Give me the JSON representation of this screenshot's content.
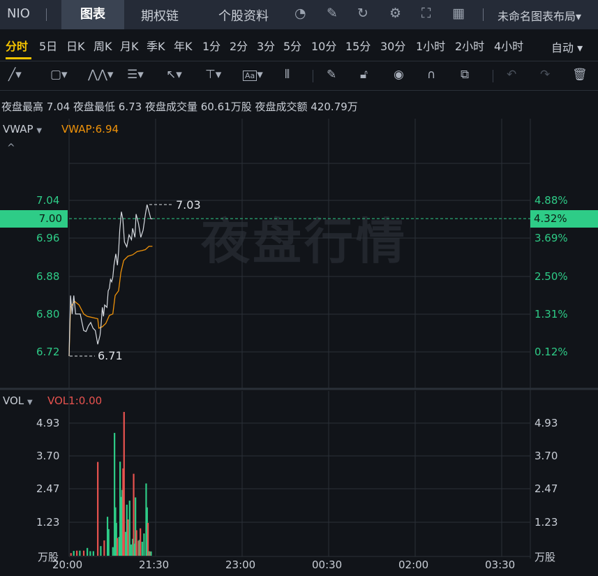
{
  "header": {
    "symbol": "NIO",
    "tabs": [
      "图表",
      "期权链",
      "个股资料"
    ],
    "icons": [
      "gauge-icon",
      "edit-icon",
      "refresh-icon",
      "gear-icon",
      "fullscreen-icon",
      "grid-icon"
    ],
    "layout_name": "未命名图表布局"
  },
  "periods": {
    "items": [
      "分时",
      "5日",
      "日K",
      "周K",
      "月K",
      "季K",
      "年K",
      "1分",
      "2分",
      "3分",
      "5分",
      "10分",
      "15分",
      "30分",
      "1小时",
      "2小时",
      "4小时"
    ],
    "active": "分时",
    "mode": "自动"
  },
  "toolbar": {
    "tools": [
      "line-tool-icon",
      "rectangle-tool-icon",
      "pattern-tool-icon",
      "fib-tool-icon",
      "arrow-tool-icon",
      "measure-tool-icon",
      "text-tool-icon",
      "candle-tool-icon",
      "pen-icon",
      "unlock-icon",
      "eye-icon",
      "magnet-icon",
      "link-icon",
      "undo-icon",
      "redo-icon",
      "trash-icon"
    ]
  },
  "info": {
    "high_label": "夜盘最高",
    "high": "7.04",
    "low_label": "夜盘最低",
    "low": "6.73",
    "vol_label": "夜盘成交量",
    "vol": "60.61万股",
    "amt_label": "夜盘成交额",
    "amt": "420.79万"
  },
  "price_panel": {
    "indicator": "VWAP",
    "indicator_value": "VWAP:6.94",
    "watermark": "夜盘行情",
    "left_ticks": [
      "7.04",
      "6.96",
      "6.88",
      "6.80",
      "6.72"
    ],
    "right_ticks": [
      "4.88%",
      "3.69%",
      "2.50%",
      "1.31%",
      "0.12%"
    ],
    "current_price": "7.00",
    "current_pct": "4.32%",
    "max_label": "7.03",
    "min_label": "6.71"
  },
  "volume_panel": {
    "indicator": "VOL",
    "indicator_value": "VOL1:0.00",
    "ticks": [
      "4.93",
      "3.70",
      "2.47",
      "1.23"
    ],
    "unit": "万股"
  },
  "time_axis": [
    "20:00",
    "21:30",
    "23:00",
    "00:30",
    "02:00",
    "03:30"
  ],
  "colors": {
    "up": "#2ecc87",
    "down": "#e8534f",
    "vwap": "#f0930a",
    "price": "#d8dce2",
    "accent": "#f5c400"
  },
  "chart_data": {
    "type": "line",
    "x_unit": "minutes since 20:00",
    "price_ylim": [
      6.7,
      7.08
    ],
    "price": [
      [
        0,
        6.711
      ],
      [
        1.5,
        6.839
      ],
      [
        3.2,
        6.8
      ],
      [
        4.9,
        6.839
      ],
      [
        6.8,
        6.8
      ],
      [
        11.6,
        6.8
      ],
      [
        15.2,
        6.765
      ],
      [
        17.7,
        6.763
      ],
      [
        20.1,
        6.775
      ],
      [
        22.5,
        6.782
      ],
      [
        24.9,
        6.77
      ],
      [
        27.3,
        6.765
      ],
      [
        29.8,
        6.736
      ],
      [
        32.2,
        6.755
      ],
      [
        33.4,
        6.78
      ],
      [
        34.6,
        6.814
      ],
      [
        35.8,
        6.795
      ],
      [
        37,
        6.819
      ],
      [
        39.4,
        6.814
      ],
      [
        40.7,
        6.849
      ],
      [
        41.9,
        6.854
      ],
      [
        43.1,
        6.873
      ],
      [
        44.3,
        6.868
      ],
      [
        45.5,
        6.878
      ],
      [
        46.7,
        6.903
      ],
      [
        48.6,
        6.927
      ],
      [
        50.3,
        6.903
      ],
      [
        51.5,
        6.932
      ],
      [
        52.7,
        6.977
      ],
      [
        54.4,
        7.016
      ],
      [
        55.9,
        7.001
      ],
      [
        57.6,
        6.952
      ],
      [
        60,
        6.942
      ],
      [
        62.4,
        6.967
      ],
      [
        64.9,
        6.957
      ],
      [
        66.1,
        6.981
      ],
      [
        68.5,
        6.962
      ],
      [
        69.7,
        7.011
      ],
      [
        72.2,
        6.991
      ],
      [
        74.6,
        6.962
      ],
      [
        77,
        6.977
      ],
      [
        79.4,
        7.011
      ],
      [
        81.1,
        7.031
      ],
      [
        83.1,
        7.016
      ],
      [
        85,
        7.001
      ],
      [
        86.7,
        7.001
      ]
    ],
    "vwap": [
      [
        0,
        6.711
      ],
      [
        1.5,
        6.814
      ],
      [
        5.6,
        6.827
      ],
      [
        10.4,
        6.819
      ],
      [
        15.2,
        6.8
      ],
      [
        18.9,
        6.795
      ],
      [
        29.8,
        6.79
      ],
      [
        31,
        6.77
      ],
      [
        34.6,
        6.773
      ],
      [
        38.2,
        6.78
      ],
      [
        41.9,
        6.797
      ],
      [
        45.5,
        6.8
      ],
      [
        47.9,
        6.839
      ],
      [
        51.5,
        6.849
      ],
      [
        53.9,
        6.888
      ],
      [
        56.8,
        6.913
      ],
      [
        61.2,
        6.922
      ],
      [
        66.1,
        6.925
      ],
      [
        70.9,
        6.932
      ],
      [
        75.8,
        6.934
      ],
      [
        79.4,
        6.936
      ],
      [
        83.1,
        6.943
      ],
      [
        86.7,
        6.943
      ]
    ],
    "volume_ylim": [
      0,
      4.93
    ],
    "volume": [
      [
        1.9,
        0.1,
        "down"
      ],
      [
        4.8,
        0.18,
        "up"
      ],
      [
        8,
        0.19,
        "down"
      ],
      [
        11.1,
        0.19,
        "up"
      ],
      [
        15.2,
        0.19,
        "down"
      ],
      [
        18.9,
        0.29,
        "up"
      ],
      [
        22,
        0.17,
        "up"
      ],
      [
        25.2,
        0.17,
        "up"
      ],
      [
        29.8,
        3.49,
        "down"
      ],
      [
        32.9,
        0.36,
        "up"
      ],
      [
        36.5,
        0.57,
        "down"
      ],
      [
        39.9,
        1.45,
        "up"
      ],
      [
        41.1,
        0.99,
        "up"
      ],
      [
        45.5,
        0.32,
        "up"
      ],
      [
        47.2,
        4.57,
        "up"
      ],
      [
        48.2,
        1.8,
        "up"
      ],
      [
        49.1,
        1.22,
        "up"
      ],
      [
        50.1,
        0.66,
        "down"
      ],
      [
        52,
        0.7,
        "up"
      ],
      [
        53,
        3.5,
        "up"
      ],
      [
        54.2,
        2.19,
        "up"
      ],
      [
        55.2,
        2.45,
        "up"
      ],
      [
        56.1,
        3.25,
        "down"
      ],
      [
        57.1,
        5.35,
        "down"
      ],
      [
        58.8,
        0.89,
        "up"
      ],
      [
        60,
        1.9,
        "up"
      ],
      [
        61.2,
        1.35,
        "down"
      ],
      [
        62.9,
        2.05,
        "up"
      ],
      [
        64.4,
        0.42,
        "up"
      ],
      [
        66.1,
        0.63,
        "up"
      ],
      [
        67.1,
        3.05,
        "down"
      ],
      [
        68,
        0.45,
        "up"
      ],
      [
        69,
        2.17,
        "up"
      ],
      [
        70,
        0.95,
        "down"
      ],
      [
        72.1,
        0.56,
        "down"
      ],
      [
        73.1,
        0.59,
        "up"
      ],
      [
        74.1,
        1.02,
        "down"
      ],
      [
        76,
        0.52,
        "up"
      ],
      [
        77.9,
        0.83,
        "up"
      ],
      [
        80.1,
        2.69,
        "up"
      ],
      [
        81.1,
        1.8,
        "up"
      ],
      [
        82,
        1.22,
        "down"
      ],
      [
        83.2,
        0.17,
        "up"
      ],
      [
        84.2,
        0.16,
        "down"
      ],
      [
        85.2,
        0.16,
        "up"
      ]
    ]
  }
}
